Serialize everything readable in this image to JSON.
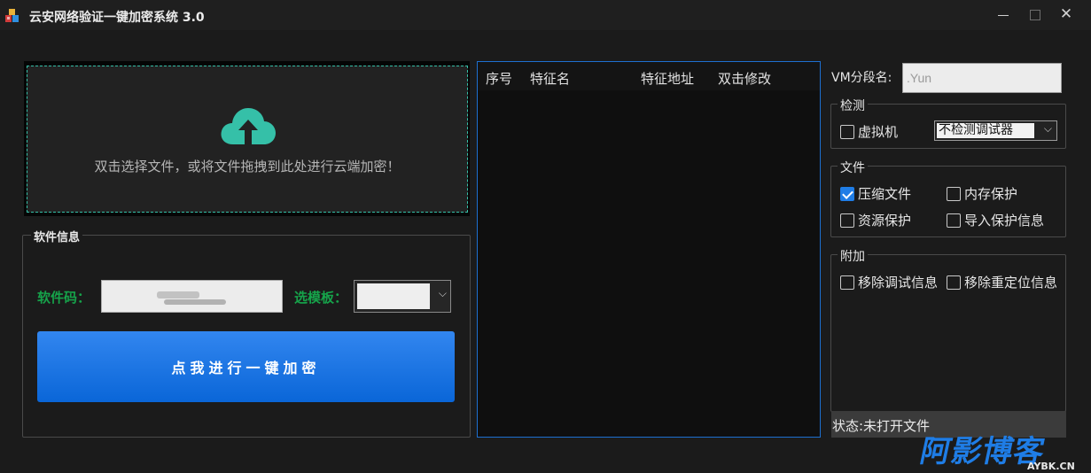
{
  "window": {
    "title": "云安网络验证一键加密系统 3.0",
    "controls": {
      "minimize": "–",
      "maximize": "□",
      "close": "✕"
    }
  },
  "drop_zone": {
    "icon": "cloud-upload-icon",
    "text": "双击选择文件，或将文件拖拽到此处进行云端加密！",
    "accent_color": "#35c0a8"
  },
  "software_info": {
    "legend": "软件信息",
    "code_label": "软件码：",
    "code_value": "",
    "template_label": "选模板：",
    "template_value": "",
    "encrypt_button": "点我进行一键加密",
    "label_color": "#16a34a",
    "button_color": "#1f7de6"
  },
  "feature_table": {
    "columns": [
      "序号",
      "特征名",
      "特征地址",
      "双击修改"
    ],
    "rows": []
  },
  "vm_section": {
    "label": "VM分段名:",
    "value": ".Yun"
  },
  "detect_group": {
    "legend": "检测",
    "vm_checkbox": {
      "label": "虚拟机",
      "checked": false
    },
    "debugger_select": "不检测调试器"
  },
  "file_group": {
    "legend": "文件",
    "options": [
      {
        "label": "压缩文件",
        "checked": true
      },
      {
        "label": "内存保护",
        "checked": false
      },
      {
        "label": "资源保护",
        "checked": false
      },
      {
        "label": "导入保护信息",
        "checked": false
      }
    ]
  },
  "extra_group": {
    "legend": "附加",
    "options": [
      {
        "label": "移除调试信息",
        "checked": false
      },
      {
        "label": "移除重定位信息",
        "checked": false
      }
    ]
  },
  "status": "状态:未打开文件",
  "watermark": {
    "main": "阿影博客",
    "sub": "AYBK.CN"
  }
}
